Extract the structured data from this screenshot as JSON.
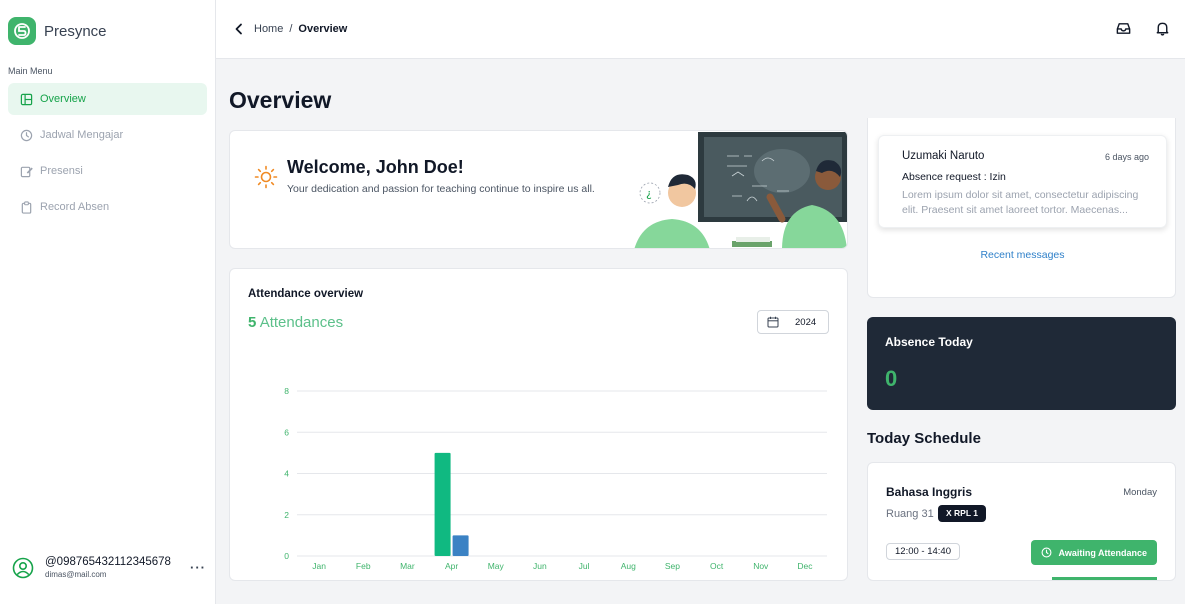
{
  "app": {
    "name": "Presynce"
  },
  "sidebar": {
    "menu_title": "Main Menu",
    "items": [
      {
        "label": "Overview",
        "icon": "layout-icon",
        "active": true
      },
      {
        "label": "Jadwal Mengajar",
        "icon": "clock-icon",
        "active": false
      },
      {
        "label": "Presensi",
        "icon": "edit-icon",
        "active": false
      },
      {
        "label": "Record Absen",
        "icon": "clipboard-icon",
        "active": false
      }
    ],
    "user": {
      "name": "@098765432112345678",
      "email": "dimas@mail.com"
    }
  },
  "header": {
    "breadcrumb": {
      "home": "Home",
      "separator": "/",
      "current": "Overview"
    }
  },
  "page": {
    "title": "Overview"
  },
  "welcome": {
    "title": "Welcome, John Doe!",
    "subtitle": "Your dedication and passion for teaching continue to inspire us all."
  },
  "attendance": {
    "title": "Attendance overview",
    "count": "5",
    "count_label": "Attendances",
    "year": "2024"
  },
  "messages": {
    "items": [
      {
        "name": "Uzumaki Naruto",
        "time": "6 days ago",
        "subject": "Absence request : Izin",
        "body": "Lorem ipsum dolor sit amet, consectetur adipiscing elit. Praesent sit amet laoreet tortor. Maecenas..."
      }
    ],
    "link": "Recent messages"
  },
  "absence": {
    "title": "Absence Today",
    "value": "0"
  },
  "schedule": {
    "title": "Today Schedule",
    "items": [
      {
        "subject": "Bahasa Inggris",
        "day": "Monday",
        "room": "Ruang 31",
        "class": "X RPL 1",
        "time": "12:00 - 14:40",
        "status": "Awaiting Attendance"
      }
    ]
  },
  "colors": {
    "brand": "#3fb46c",
    "bar_primary": "#10b981",
    "bar_secondary": "#3b82c4",
    "dark_card": "#1f2937",
    "link": "#2f80c9"
  },
  "chart_data": {
    "type": "bar",
    "categories": [
      "Jan",
      "Feb",
      "Mar",
      "Apr",
      "May",
      "Jun",
      "Jul",
      "Aug",
      "Sep",
      "Oct",
      "Nov",
      "Dec"
    ],
    "series": [
      {
        "values": [
          0,
          0,
          0,
          5,
          0,
          0,
          0,
          0,
          0,
          0,
          0,
          0
        ],
        "color": "#10b981"
      },
      {
        "values": [
          0,
          0,
          0,
          1,
          0,
          0,
          0,
          0,
          0,
          0,
          0,
          0
        ],
        "color": "#3b82c4"
      }
    ],
    "y_ticks": [
      0,
      2,
      4,
      6,
      8
    ],
    "ylim": [
      0,
      8
    ],
    "grid": true,
    "legend": "none"
  }
}
